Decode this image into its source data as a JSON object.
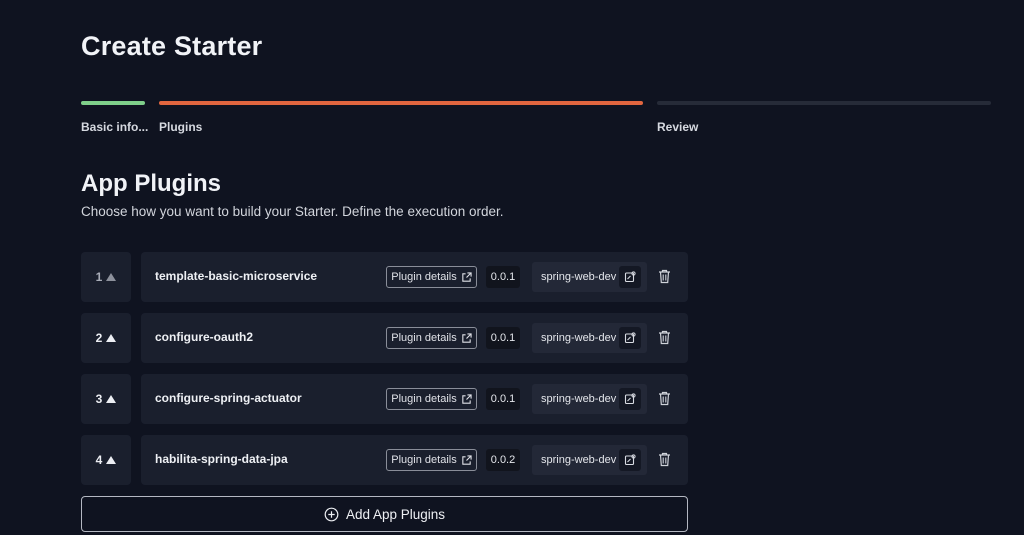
{
  "header": {
    "title": "Create Starter"
  },
  "stepper": {
    "steps": [
      {
        "label": "Basic info...",
        "status": "complete",
        "color": "#7fcf8a"
      },
      {
        "label": "Plugins",
        "status": "active",
        "color": "#e2663f"
      },
      {
        "label": "Review",
        "status": "pending",
        "color": "#262b38"
      }
    ]
  },
  "section": {
    "title": "App Plugins",
    "subtitle": "Choose how you want to build your Starter. Define the execution order."
  },
  "plugins": [
    {
      "order": "1",
      "name": "template-basic-microservice",
      "details_label": "Plugin details",
      "version": "0.0.1",
      "profile": "spring-web-dev"
    },
    {
      "order": "2",
      "name": "configure-oauth2",
      "details_label": "Plugin details",
      "version": "0.0.1",
      "profile": "spring-web-dev"
    },
    {
      "order": "3",
      "name": "configure-spring-actuator",
      "details_label": "Plugin details",
      "version": "0.0.1",
      "profile": "spring-web-dev"
    },
    {
      "order": "4",
      "name": "habilita-spring-data-jpa",
      "details_label": "Plugin details",
      "version": "0.0.2",
      "profile": "spring-web-dev"
    }
  ],
  "footer": {
    "add_label": "Add App Plugins"
  },
  "icons": {
    "move_up": "triangle-up-icon",
    "details": "external-link-icon",
    "profile_edit": "edit-settings-icon",
    "delete": "trash-icon",
    "add": "plus-circle-icon"
  }
}
